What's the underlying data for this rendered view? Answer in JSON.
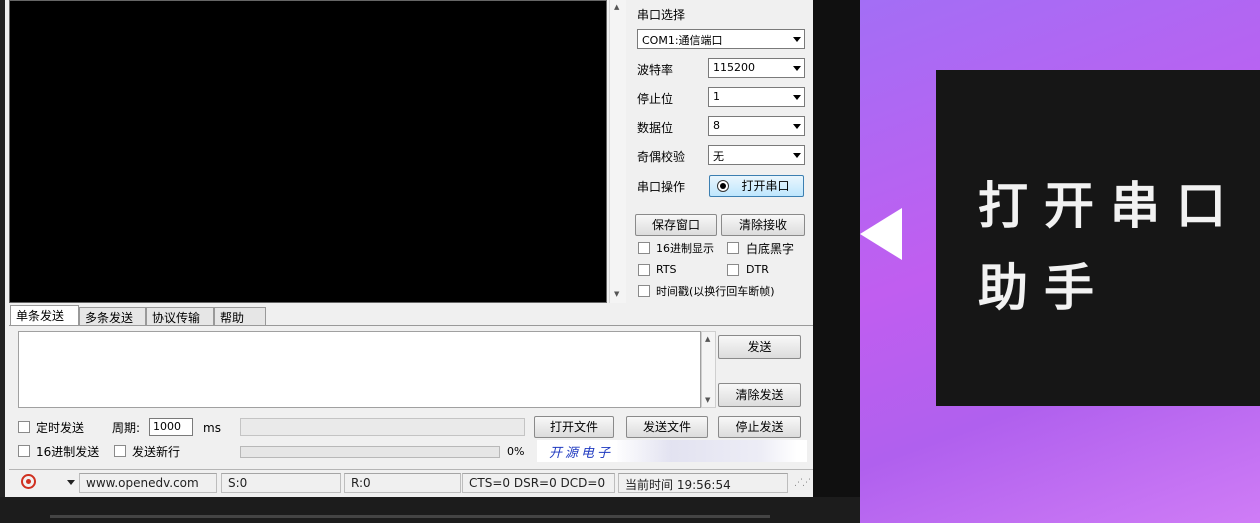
{
  "serial": {
    "port_label": "串口选择",
    "port_value": "COM1:通信端口",
    "baud_label": "波特率",
    "baud_value": "115200",
    "stop_label": "停止位",
    "stop_value": "1",
    "data_label": "数据位",
    "data_value": "8",
    "parity_label": "奇偶校验",
    "parity_value": "无",
    "op_label": "串口操作",
    "open_button": "打开串口",
    "save_window": "保存窗口",
    "clear_recv": "清除接收",
    "hex_display": "16进制显示",
    "white_bg": "白底黑字",
    "rts": "RTS",
    "dtr": "DTR",
    "timestamp": "时间戳(以换行回车断帧)"
  },
  "tabs": [
    "单条发送",
    "多条发送",
    "协议传输",
    "帮助"
  ],
  "send": {
    "send_button": "发送",
    "clear_send": "清除发送",
    "timed_send": "定时发送",
    "period_label": "周期:",
    "period_value": "1000",
    "period_unit": "ms",
    "open_file": "打开文件",
    "send_file": "发送文件",
    "stop_send": "停止发送",
    "hex_send": "16进制发送",
    "send_newline": "发送新行",
    "progress_percent": "0%",
    "progress_value": 0,
    "banner": "开源电子"
  },
  "status": {
    "website": "www.openedv.com",
    "sent": "S:0",
    "recv": "R:0",
    "lines": "CTS=0 DSR=0 DCD=0",
    "time": "当前时间 19:56:54"
  },
  "slide": {
    "line1": "打开串口",
    "line2": "助手"
  },
  "colors": {
    "slide_gradient_start": "#a36ef5",
    "slide_gradient_end": "#cf7cf6",
    "banner_text": "#1f3ac0",
    "status_icon": "#d03020"
  },
  "icons": {
    "status_icon": "record-icon",
    "dropdown": "chevron-down-icon"
  }
}
